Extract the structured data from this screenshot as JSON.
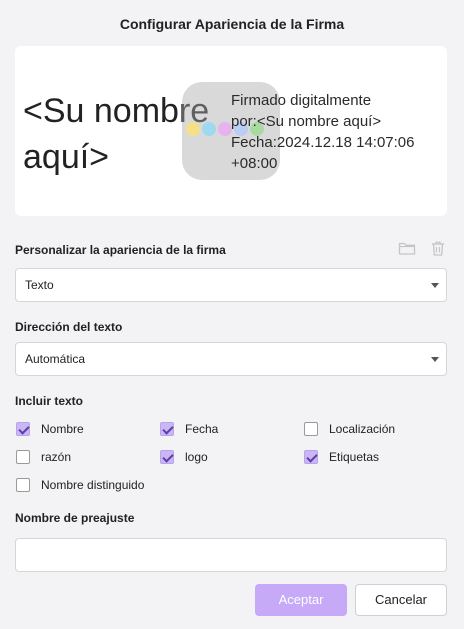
{
  "dialog": {
    "title": "Configurar Apariencia de la Firma"
  },
  "preview": {
    "name_text": "<Su nombre aquí>",
    "info_lines": [
      "Firmado digitalmente",
      "por:<Su nombre aquí>",
      "Fecha:2024.12.18 14:07:06",
      "+08:00"
    ],
    "logo_icon": "app-logo-icon",
    "logo_dot_colors": [
      "#f5e08a",
      "#9fd9ef",
      "#e6b3ef",
      "#b9cdf7",
      "#a9d9a1"
    ]
  },
  "appearance": {
    "label": "Personalizar la apariencia de la firma",
    "icons": [
      "folder-icon",
      "trash-icon"
    ],
    "selected": "Texto"
  },
  "direction": {
    "label": "Dirección del texto",
    "selected": "Automática"
  },
  "include_text": {
    "label": "Incluir texto",
    "options": [
      {
        "label": "Nombre",
        "checked": true
      },
      {
        "label": "Fecha",
        "checked": true
      },
      {
        "label": "Localización",
        "checked": false
      },
      {
        "label": "razón",
        "checked": false
      },
      {
        "label": "logo",
        "checked": true
      },
      {
        "label": "Etiquetas",
        "checked": true
      },
      {
        "label": "Nombre distinguido",
        "checked": false
      }
    ]
  },
  "preset": {
    "label": "Nombre de preajuste",
    "value": "",
    "placeholder": ""
  },
  "buttons": {
    "accept": "Aceptar",
    "cancel": "Cancelar"
  },
  "colors": {
    "accent": "#c6a9f7",
    "checkbox_checked": "#c9b6f2"
  }
}
